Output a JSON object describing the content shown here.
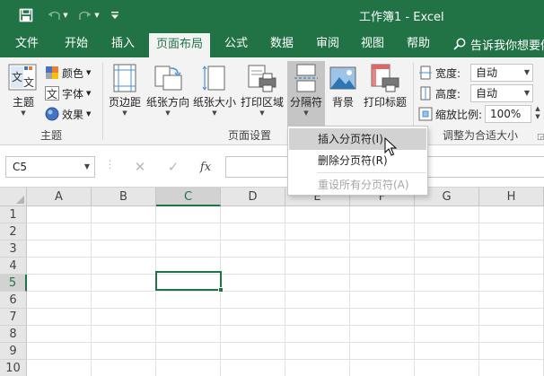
{
  "window": {
    "title": "工作簿1  -  Excel",
    "accent": "#217346"
  },
  "quick_access": {
    "save_icon": "save-icon",
    "undo_icon": "undo-icon",
    "redo_icon": "redo-icon",
    "customize_icon": "customize-icon"
  },
  "tabs": [
    {
      "label": "文件"
    },
    {
      "label": "开始"
    },
    {
      "label": "插入"
    },
    {
      "label": "页面布局",
      "active": true
    },
    {
      "label": "公式"
    },
    {
      "label": "数据"
    },
    {
      "label": "审阅"
    },
    {
      "label": "视图"
    },
    {
      "label": "帮助"
    }
  ],
  "tell_me": "告诉我你想要做",
  "ribbon": {
    "themes_group": {
      "label": "主题",
      "theme_button": "主题",
      "colors": "颜色",
      "fonts": "字体",
      "effects": "效果",
      "theme_icon_text": "文文"
    },
    "page_setup_group": {
      "label": "页面设置",
      "margins": "页边距",
      "orientation": "纸张方向",
      "size": "纸张大小",
      "print_area": "打印区域",
      "breaks": "分隔符",
      "background": "背景",
      "print_titles": "打印标题"
    },
    "scale_group": {
      "label": "调整为合适大小",
      "width_label": "宽度:",
      "width_value": "自动",
      "height_label": "高度:",
      "height_value": "自动",
      "scale_label": "缩放比例:",
      "scale_value": "100%"
    }
  },
  "breaks_menu": {
    "items": [
      {
        "label": "插入分页符(I)",
        "hot": true,
        "disabled": false
      },
      {
        "label": "删除分页符(R)",
        "hot": false,
        "disabled": false
      },
      {
        "label": "重设所有分页符(A)",
        "hot": false,
        "disabled": true
      }
    ]
  },
  "formula_bar": {
    "name_box": "C5",
    "cancel_icon": "cancel-icon",
    "enter_icon": "check-icon",
    "fx": "fx",
    "content": ""
  },
  "sheet": {
    "columns": [
      "A",
      "B",
      "C",
      "D",
      "E",
      "F",
      "G",
      "H"
    ],
    "rows": [
      "1",
      "2",
      "3",
      "4",
      "5",
      "6",
      "7",
      "8",
      "9",
      "10"
    ],
    "selected_column": "C",
    "selected_row": "5",
    "active_cell": "C5"
  }
}
